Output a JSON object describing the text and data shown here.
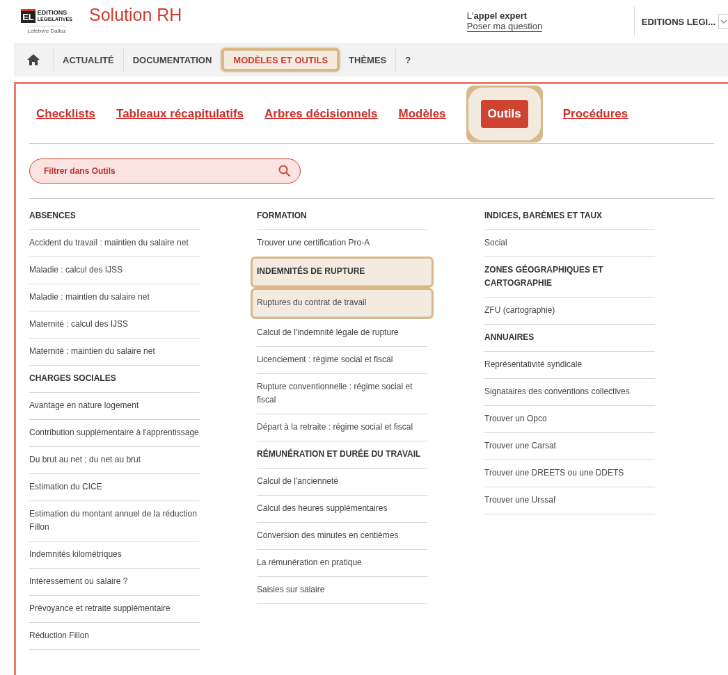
{
  "brand": {
    "logo_mark": "EL",
    "logo_line_1": "EDITIONS",
    "logo_line_2": "LEGISLATIVES",
    "logo_sub": "Lefebvre Dalloz",
    "title": "Solution RH"
  },
  "expert": {
    "prefix": "L'",
    "label": "appel expert",
    "link": "Poser ma question"
  },
  "account": {
    "label": "EDITIONS LEGI..."
  },
  "nav": [
    {
      "kind": "home",
      "selected": false,
      "highlighted": false
    },
    {
      "kind": "text",
      "label": "ACTUALITÉ",
      "selected": false,
      "highlighted": false
    },
    {
      "kind": "text",
      "label": "DOCUMENTATION",
      "selected": false,
      "highlighted": false
    },
    {
      "kind": "text",
      "label": "MODÈLES ET OUTILS",
      "selected": true,
      "highlighted": true
    },
    {
      "kind": "text",
      "label": "THÈMES",
      "selected": false,
      "highlighted": false
    },
    {
      "kind": "text",
      "label": "?",
      "selected": false,
      "highlighted": false
    }
  ],
  "subtabs": [
    {
      "label": "Checklists",
      "selected": false,
      "highlighted": false
    },
    {
      "label": "Tableaux récapitulatifs",
      "selected": false,
      "highlighted": false
    },
    {
      "label": "Arbres décisionnels",
      "selected": false,
      "highlighted": false
    },
    {
      "label": "Modèles",
      "selected": false,
      "highlighted": false
    },
    {
      "label": "Outils",
      "selected": true,
      "highlighted": true
    },
    {
      "label": "Procédures",
      "selected": false,
      "highlighted": false
    }
  ],
  "filter": {
    "placeholder": "Filtrer dans Outils"
  },
  "columns": [
    [
      {
        "kind": "heading",
        "text": "ABSENCES",
        "highlighted": false
      },
      {
        "kind": "link",
        "text": "Accident du travail : maintien du salaire net",
        "highlighted": false
      },
      {
        "kind": "link",
        "text": "Maladie : calcul des IJSS",
        "highlighted": false
      },
      {
        "kind": "link",
        "text": "Maladie : maintien du salaire net",
        "highlighted": false
      },
      {
        "kind": "link",
        "text": "Maternité : calcul des IJSS",
        "highlighted": false
      },
      {
        "kind": "link",
        "text": "Maternité : maintien du salaire net",
        "highlighted": false
      },
      {
        "kind": "heading",
        "text": "CHARGES SOCIALES",
        "highlighted": false
      },
      {
        "kind": "link",
        "text": "Avantage en nature logement",
        "highlighted": false
      },
      {
        "kind": "link",
        "text": "Contribution supplémentaire à l'apprentissage",
        "highlighted": false
      },
      {
        "kind": "link",
        "text": "Du brut au net ; du net au brut",
        "highlighted": false
      },
      {
        "kind": "link",
        "text": "Estimation du CICE",
        "highlighted": false
      },
      {
        "kind": "link",
        "text": "Estimation du montant annuel de la réduction Fillon",
        "highlighted": false
      },
      {
        "kind": "link",
        "text": "Indemnités kilométriques",
        "highlighted": false
      },
      {
        "kind": "link",
        "text": "Intéressement ou salaire ?",
        "highlighted": false
      },
      {
        "kind": "link",
        "text": "Prévoyance et retraite supplémentaire",
        "highlighted": false
      },
      {
        "kind": "link",
        "text": "Réduction Fillon",
        "highlighted": false
      }
    ],
    [
      {
        "kind": "heading",
        "text": "FORMATION",
        "highlighted": false
      },
      {
        "kind": "link",
        "text": "Trouver une certification Pro-A",
        "highlighted": false
      },
      {
        "kind": "heading",
        "text": "INDEMNITÉS DE RUPTURE",
        "highlighted": true
      },
      {
        "kind": "link",
        "text": "Ruptures du contrat de travail",
        "highlighted": true
      },
      {
        "kind": "link",
        "text": "Calcul de l'indemnité légale de rupture",
        "highlighted": false
      },
      {
        "kind": "link",
        "text": "Licenciement : régime social et fiscal",
        "highlighted": false
      },
      {
        "kind": "link",
        "text": "Rupture conventionnelle : régime social et fiscal",
        "highlighted": false
      },
      {
        "kind": "link",
        "text": "Départ à la retraite : régime social et fiscal",
        "highlighted": false
      },
      {
        "kind": "heading",
        "text": "RÉMUNÉRATION ET DURÉE DU TRAVAIL",
        "highlighted": false
      },
      {
        "kind": "link",
        "text": "Calcul de l'ancienneté",
        "highlighted": false
      },
      {
        "kind": "link",
        "text": "Calcul des heures supplémentaires",
        "highlighted": false
      },
      {
        "kind": "link",
        "text": "Conversion des minutes en centièmes",
        "highlighted": false
      },
      {
        "kind": "link",
        "text": "La rémunération en pratique",
        "highlighted": false
      },
      {
        "kind": "link",
        "text": "Saisies sur salaire",
        "highlighted": false
      }
    ],
    [
      {
        "kind": "heading",
        "text": "INDICES, BARÈMES ET TAUX",
        "highlighted": false
      },
      {
        "kind": "link",
        "text": "Social",
        "highlighted": false
      },
      {
        "kind": "heading",
        "text": "ZONES GÉOGRAPHIQUES ET CARTOGRAPHIE",
        "highlighted": false
      },
      {
        "kind": "link",
        "text": "ZFU (cartographie)",
        "highlighted": false
      },
      {
        "kind": "heading",
        "text": "ANNUAIRES",
        "highlighted": false
      },
      {
        "kind": "link",
        "text": "Représentativité syndicale",
        "highlighted": false
      },
      {
        "kind": "link",
        "text": "Signataires des conventions collectives",
        "highlighted": false
      },
      {
        "kind": "link",
        "text": "Trouver un Opco",
        "highlighted": false
      },
      {
        "kind": "link",
        "text": "Trouver une Carsat",
        "highlighted": false
      },
      {
        "kind": "link",
        "text": "Trouver une DREETS ou une DDETS",
        "highlighted": false
      },
      {
        "kind": "link",
        "text": "Trouver une Urssaf",
        "highlighted": false
      }
    ]
  ]
}
